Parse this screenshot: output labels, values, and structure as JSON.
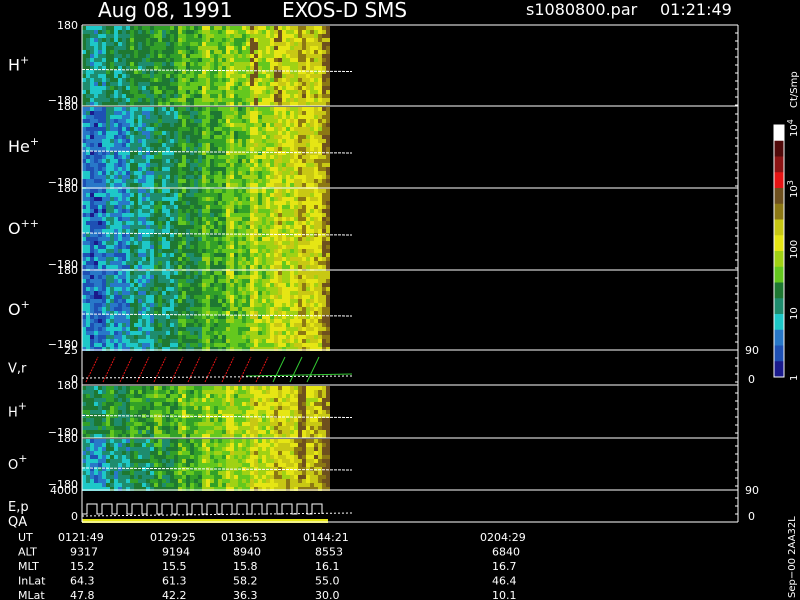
{
  "header": {
    "date": "Aug 08, 1991",
    "instrument": "EXOS-D SMS",
    "file": "s1080800.par",
    "time": "01:21:49"
  },
  "chart_data": {
    "type": "heatmap",
    "panels": [
      {
        "label": "H",
        "sup": "+",
        "ytop": "180",
        "ybot": "−180"
      },
      {
        "label": "He",
        "sup": "+",
        "ytop": "180",
        "ybot": "−180"
      },
      {
        "label": "O",
        "sup": "++",
        "ytop": "180",
        "ybot": "−180"
      },
      {
        "label": "O",
        "sup": "+",
        "ytop": "180",
        "ybot": "−180"
      },
      {
        "label": "V,r",
        "sup": "",
        "ytop": "25",
        "ybot": "0",
        "rtop": "90",
        "rbot": "0"
      },
      {
        "label": "H",
        "sup": "+",
        "ytop": "180",
        "ybot": "−180"
      },
      {
        "label": "O",
        "sup": "+",
        "ytop": "180",
        "ybot": "−180"
      },
      {
        "label": "E,p",
        "label2": "QA",
        "sup": "",
        "ytop": "4000",
        "ybot": "0",
        "rtop": "90",
        "rbot": "0"
      }
    ],
    "colorbar": {
      "unit": "Ct/Smp",
      "ticks": [
        {
          "label": "1",
          "value": 1
        },
        {
          "label": "10",
          "value": 10
        },
        {
          "label": "100",
          "value": 100
        },
        {
          "label": "10",
          "sup": "3",
          "value": 1000
        },
        {
          "label": "10",
          "sup": "4",
          "value": 10000
        }
      ]
    }
  },
  "footer": {
    "rows": [
      {
        "name": "UT",
        "values": [
          "0121:49",
          "0129:25",
          "0136:53",
          "0144:21",
          "0204:29"
        ]
      },
      {
        "name": "ALT",
        "values": [
          "9317",
          "9194",
          "8940",
          "8553",
          "6840"
        ]
      },
      {
        "name": "MLT",
        "values": [
          "15.2",
          "15.5",
          "15.8",
          "16.1",
          "16.7"
        ]
      },
      {
        "name": "InLat",
        "values": [
          "64.3",
          "61.3",
          "58.2",
          "55.0",
          "46.4"
        ]
      },
      {
        "name": "MLat",
        "values": [
          "47.8",
          "42.2",
          "36.3",
          "30.0",
          "10.1"
        ]
      }
    ],
    "stamp": "Sep−00 2AA32L"
  },
  "colors": {
    "scale": [
      "#1a1a8c",
      "#1e50b4",
      "#2878c8",
      "#1ec8c8",
      "#1e8c6e",
      "#1e7832",
      "#32a028",
      "#64c81e",
      "#a0d214",
      "#e6e614",
      "#c8c814",
      "#8c7814",
      "#6e501e",
      "#e61414",
      "#8c1414",
      "#500a0a"
    ]
  }
}
